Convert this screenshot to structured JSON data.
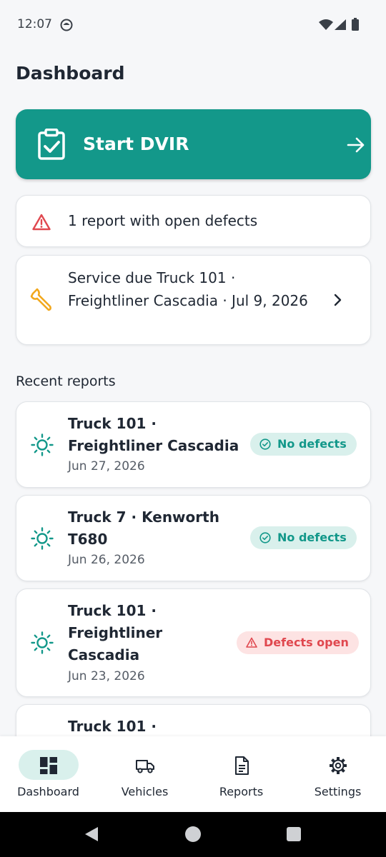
{
  "status_bar": {
    "time": "12:07"
  },
  "header": {
    "title": "Dashboard"
  },
  "start_dvir": {
    "label": "Start DVIR"
  },
  "alert": {
    "text": "1 report with open defects"
  },
  "service_due": {
    "text": "Service due Truck 101 · Freightliner Cascadia · Jul 9, 2026"
  },
  "recent": {
    "title": "Recent reports",
    "items": [
      {
        "title": "Truck 101 · Freightliner Cascadia",
        "date": "Jun 27, 2026",
        "status": "No defects",
        "status_type": "ok"
      },
      {
        "title": "Truck 7 · Kenworth T680",
        "date": "Jun 26, 2026",
        "status": "No defects",
        "status_type": "ok"
      },
      {
        "title": "Truck 101 · Freightliner Cascadia",
        "date": "Jun 23, 2026",
        "status": "Defects open",
        "status_type": "bad"
      },
      {
        "title": "Truck 101 ·",
        "date": "",
        "status": "",
        "status_type": ""
      }
    ]
  },
  "nav": {
    "items": [
      {
        "label": "Dashboard",
        "icon": "dashboard-icon",
        "active": true
      },
      {
        "label": "Vehicles",
        "icon": "truck-icon",
        "active": false
      },
      {
        "label": "Reports",
        "icon": "document-icon",
        "active": false
      },
      {
        "label": "Settings",
        "icon": "gear-icon",
        "active": false
      }
    ]
  },
  "colors": {
    "accent": "#13988a",
    "danger": "#e0484f",
    "ok_bg": "#d9f0ec",
    "bad_bg": "#fde3e3",
    "wrench": "#f2a81d"
  }
}
